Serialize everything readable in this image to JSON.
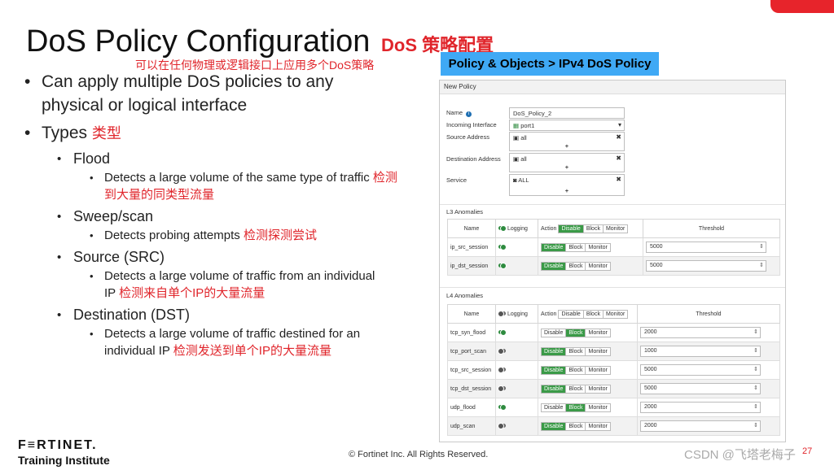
{
  "slide": {
    "title": "DoS Policy Configuration",
    "title_cn": "DoS 策略配置",
    "subtitle_cn": "可以在任何物理或逻辑接口上应用多个DoS策略",
    "breadcrumb": "Policy & Objects > IPv4 DoS Policy",
    "page_number": "27"
  },
  "bullets": {
    "apply": "Can apply multiple DoS policies to any physical or logical interface",
    "types": "Types",
    "types_cn": "类型",
    "flood": "Flood",
    "flood_desc": "Detects a large volume of the same type of traffic",
    "flood_cn": "检测到大量的同类型流量",
    "sweep": "Sweep/scan",
    "sweep_desc": "Detects probing attempts",
    "sweep_cn": "检测探测尝试",
    "source": "Source (SRC)",
    "source_desc": "Detects a large volume of traffic from an individual IP",
    "source_cn": "检测来自单个IP的大量流量",
    "dest": "Destination (DST)",
    "dest_desc": "Detects a large volume of traffic destined for an individual IP",
    "dest_cn": "检测发送到单个IP的大量流量"
  },
  "footer": {
    "logo": "F≡RTINET.",
    "logo_sub": "Training Institute",
    "copyright": "© Fortinet Inc. All Rights Reserved.",
    "watermark": "CSDN @飞塔老梅子"
  },
  "panel": {
    "header": "New Policy",
    "name_label": "Name",
    "name_value": "DoS_Policy_2",
    "incoming_label": "Incoming Interface",
    "incoming_value": "port1",
    "source_label": "Source Address",
    "source_value": "all",
    "dest_label": "Destination Address",
    "dest_value": "all",
    "service_label": "Service",
    "service_value": "ALL",
    "plus": "+",
    "remove": "✖",
    "l3_label": "L3 Anomalies",
    "l4_label": "L4 Anomalies",
    "col_name": "Name",
    "col_logging": "Logging",
    "col_action": "Action",
    "col_threshold": "Threshold",
    "opt_disable": "Disable",
    "opt_block": "Block",
    "opt_monitor": "Monitor",
    "l3_rows": [
      {
        "name": "ip_src_session",
        "logging": true,
        "action": "Disable",
        "threshold": "5000"
      },
      {
        "name": "ip_dst_session",
        "logging": true,
        "action": "Disable",
        "threshold": "5000"
      }
    ],
    "l4_rows": [
      {
        "name": "tcp_syn_flood",
        "logging": true,
        "action": "Block",
        "threshold": "2000"
      },
      {
        "name": "tcp_port_scan",
        "logging": false,
        "action": "Disable",
        "threshold": "1000"
      },
      {
        "name": "tcp_src_session",
        "logging": false,
        "action": "Disable",
        "threshold": "5000"
      },
      {
        "name": "tcp_dst_session",
        "logging": false,
        "action": "Disable",
        "threshold": "5000"
      },
      {
        "name": "udp_flood",
        "logging": true,
        "action": "Block",
        "threshold": "2000"
      },
      {
        "name": "udp_scan",
        "logging": false,
        "action": "Disable",
        "threshold": "2000"
      }
    ]
  }
}
